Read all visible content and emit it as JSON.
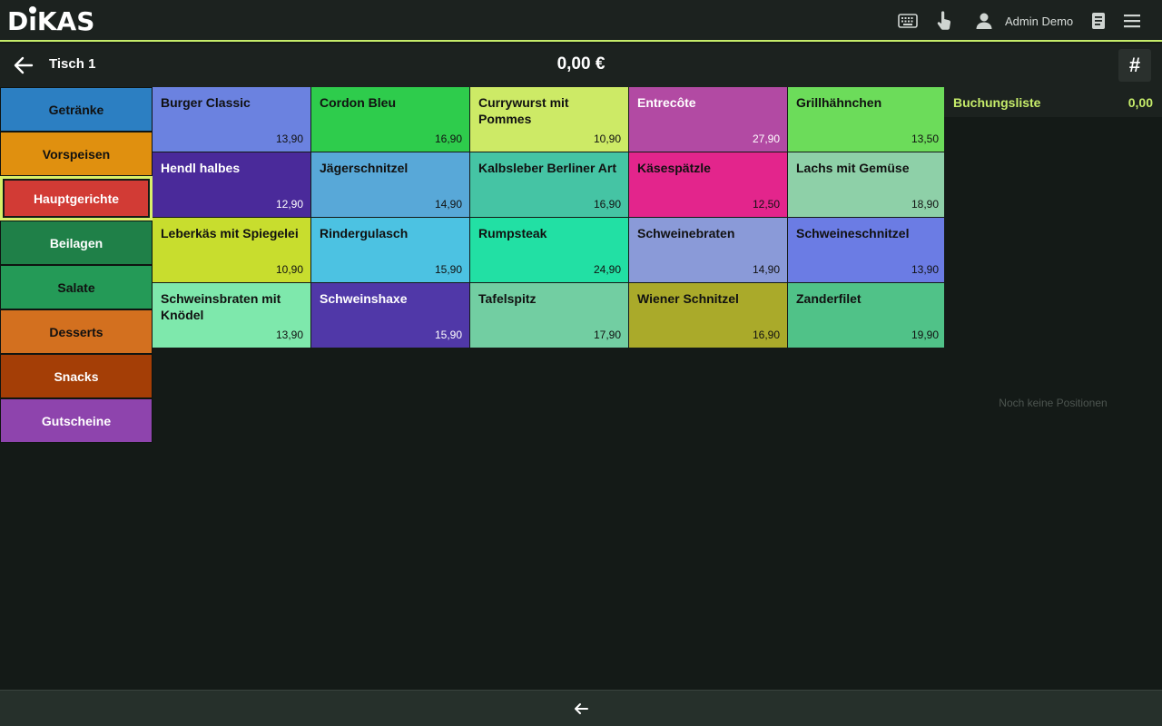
{
  "header": {
    "logo_text": "DIKAS",
    "user_name": "Admin Demo",
    "accent_color": "#c6ec6a",
    "icons": [
      "keyboard-icon",
      "touch-icon",
      "user-icon",
      "book-icon",
      "menu-icon"
    ]
  },
  "subheader": {
    "table_name": "Tisch 1",
    "total": "0,00 €",
    "hash_label": "#"
  },
  "categories": [
    {
      "label": "Getränke",
      "color": "#2c7fc2",
      "text_color": "#111111"
    },
    {
      "label": "Vorspeisen",
      "color": "#e0900f",
      "text_color": "#111111"
    },
    {
      "label": "Hauptgerichte",
      "color": "#d23b35",
      "text_color": "#ffffff",
      "active": true
    },
    {
      "label": "Beilagen",
      "color": "#1f8048",
      "text_color": "#ffffff"
    },
    {
      "label": "Salate",
      "color": "#249a57",
      "text_color": "#111111"
    },
    {
      "label": "Desserts",
      "color": "#d3701f",
      "text_color": "#111111"
    },
    {
      "label": "Snacks",
      "color": "#a43e06",
      "text_color": "#ffffff"
    },
    {
      "label": "Gutscheine",
      "color": "#8e44ad",
      "text_color": "#ffffff"
    }
  ],
  "products": [
    {
      "name": "Burger Classic",
      "price": "13,90",
      "color": "#6b82e0",
      "text_color": "#111111"
    },
    {
      "name": "Cordon Bleu",
      "price": "16,90",
      "color": "#2ecc4c",
      "text_color": "#111111"
    },
    {
      "name": "Currywurst mit Pommes",
      "price": "10,90",
      "color": "#cdea66",
      "text_color": "#111111"
    },
    {
      "name": "Entrecôte",
      "price": "27,90",
      "color": "#b24aa3",
      "text_color": "#ffffff"
    },
    {
      "name": "Grillhähnchen",
      "price": "13,50",
      "color": "#6cdc5a",
      "text_color": "#111111"
    },
    {
      "name": "Hendl halbes",
      "price": "12,90",
      "color": "#4a2a9a",
      "text_color": "#ffffff"
    },
    {
      "name": "Jägerschnitzel",
      "price": "14,90",
      "color": "#58a8d8",
      "text_color": "#111111"
    },
    {
      "name": "Kalbsleber Berliner Art",
      "price": "16,90",
      "color": "#45c4a4",
      "text_color": "#111111"
    },
    {
      "name": "Käsespätzle",
      "price": "12,50",
      "color": "#e3258c",
      "text_color": "#111111"
    },
    {
      "name": "Lachs mit Gemüse",
      "price": "18,90",
      "color": "#8ed0a8",
      "text_color": "#111111"
    },
    {
      "name": "Leberkäs mit Spiegelei",
      "price": "10,90",
      "color": "#c8dd2e",
      "text_color": "#111111"
    },
    {
      "name": "Rindergulasch",
      "price": "15,90",
      "color": "#4cc2e2",
      "text_color": "#111111"
    },
    {
      "name": "Rumpsteak",
      "price": "24,90",
      "color": "#22e0a4",
      "text_color": "#111111"
    },
    {
      "name": "Schweinebraten",
      "price": "14,90",
      "color": "#8a9ad8",
      "text_color": "#111111"
    },
    {
      "name": "Schweineschnitzel",
      "price": "13,90",
      "color": "#6b7ce4",
      "text_color": "#111111"
    },
    {
      "name": "Schweinsbraten mit Knödel",
      "price": "13,90",
      "color": "#7ee8ac",
      "text_color": "#111111"
    },
    {
      "name": "Schweinshaxe",
      "price": "15,90",
      "color": "#5038a8",
      "text_color": "#ffffff"
    },
    {
      "name": "Tafelspitz",
      "price": "17,90",
      "color": "#72cea2",
      "text_color": "#111111"
    },
    {
      "name": "Wiener Schnitzel",
      "price": "16,90",
      "color": "#aaaa2a",
      "text_color": "#111111"
    },
    {
      "name": "Zanderfilet",
      "price": "19,90",
      "color": "#50c288",
      "text_color": "#111111"
    }
  ],
  "booking_list": {
    "title": "Buchungsliste",
    "total": "0,00",
    "empty_text": "Noch keine Positionen"
  },
  "footer": {
    "icon": "back-arrow-icon"
  }
}
